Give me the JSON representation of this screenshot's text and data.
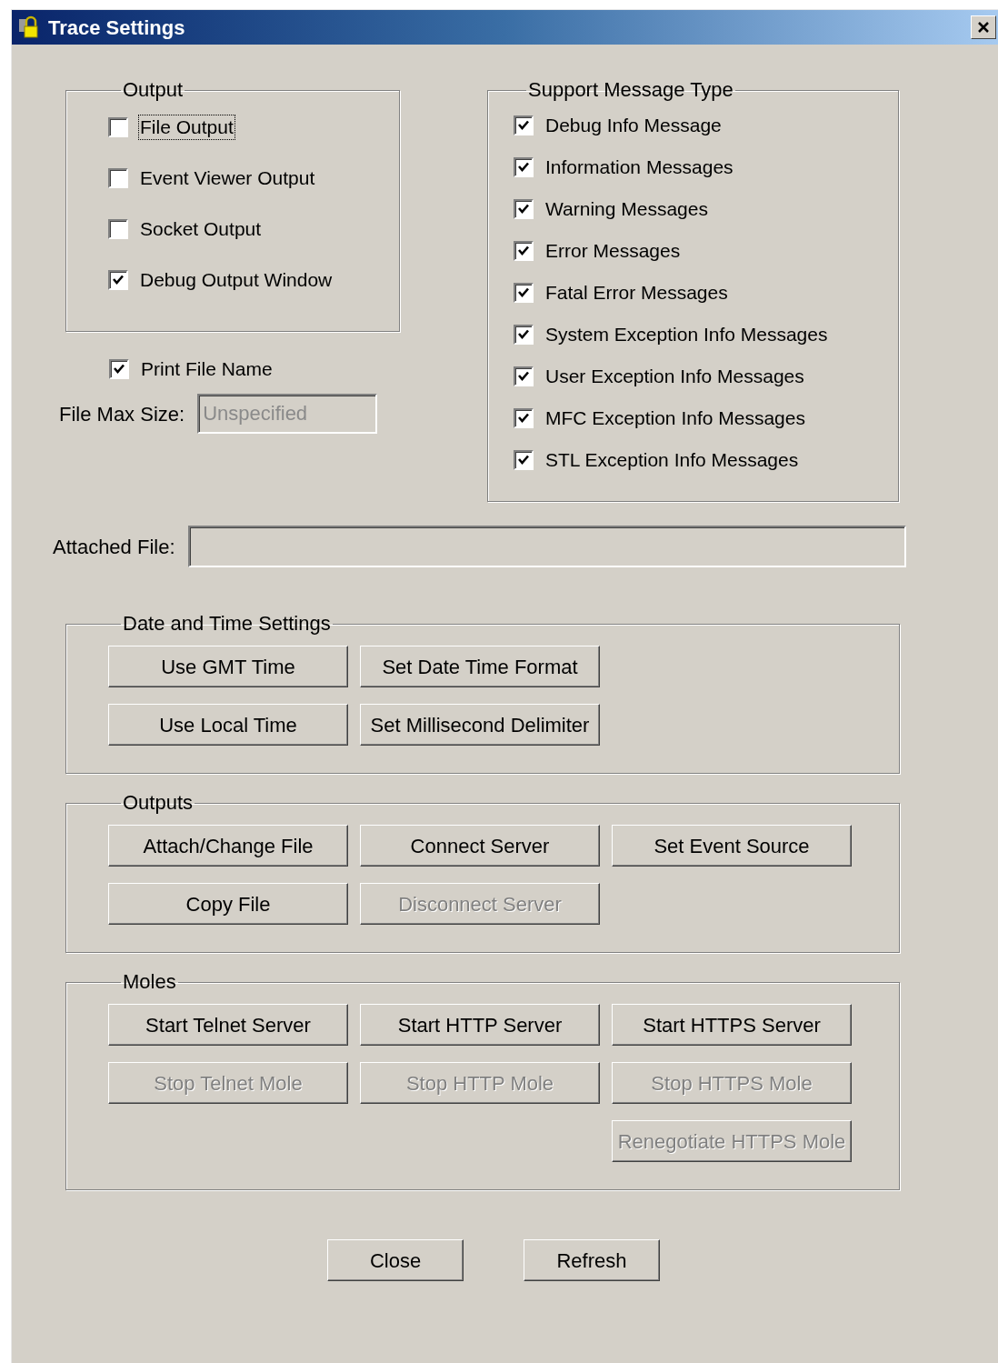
{
  "window": {
    "title": "Trace Settings"
  },
  "output_group": {
    "title": "Output",
    "options": [
      {
        "label": "File Output",
        "checked": false,
        "focused": true
      },
      {
        "label": "Event Viewer Output",
        "checked": false,
        "focused": false
      },
      {
        "label": "Socket Output",
        "checked": false,
        "focused": false
      },
      {
        "label": "Debug Output Window",
        "checked": true,
        "focused": false
      }
    ]
  },
  "print_file_name": {
    "label": "Print File Name",
    "checked": true
  },
  "file_max_size": {
    "label": "File Max Size:",
    "value": "Unspecified",
    "disabled": true
  },
  "support_group": {
    "title": "Support Message Type",
    "options": [
      {
        "label": "Debug Info Message",
        "checked": true
      },
      {
        "label": "Information Messages",
        "checked": true
      },
      {
        "label": "Warning Messages",
        "checked": true
      },
      {
        "label": "Error Messages",
        "checked": true
      },
      {
        "label": "Fatal Error Messages",
        "checked": true
      },
      {
        "label": "System Exception Info Messages",
        "checked": true
      },
      {
        "label": "User Exception Info Messages",
        "checked": true
      },
      {
        "label": "MFC Exception Info Messages",
        "checked": true
      },
      {
        "label": "STL Exception Info Messages",
        "checked": true
      }
    ]
  },
  "attached_file": {
    "label": "Attached File:"
  },
  "groups": [
    {
      "title": "Date and Time Settings",
      "columns": [
        {
          "buttons": [
            {
              "label": "Use GMT Time",
              "disabled": false
            },
            {
              "label": "Use Local Time",
              "disabled": false
            }
          ]
        },
        {
          "buttons": [
            {
              "label": "Set Date Time Format",
              "disabled": false
            },
            {
              "label": "Set Millisecond Delimiter",
              "disabled": false
            }
          ]
        }
      ]
    },
    {
      "title": "Outputs",
      "columns": [
        {
          "buttons": [
            {
              "label": "Attach/Change File",
              "disabled": false
            },
            {
              "label": "Copy File",
              "disabled": false
            }
          ]
        },
        {
          "buttons": [
            {
              "label": "Connect Server",
              "disabled": false
            },
            {
              "label": "Disconnect Server",
              "disabled": true
            }
          ]
        },
        {
          "buttons": [
            {
              "label": "Set Event Source",
              "disabled": false
            }
          ]
        }
      ]
    },
    {
      "title": "Moles",
      "columns": [
        {
          "buttons": [
            {
              "label": "Start Telnet Server",
              "disabled": false
            },
            {
              "label": "Stop Telnet Mole",
              "disabled": true
            }
          ]
        },
        {
          "buttons": [
            {
              "label": "Start HTTP Server",
              "disabled": false
            },
            {
              "label": "Stop HTTP Mole",
              "disabled": true
            }
          ]
        },
        {
          "buttons": [
            {
              "label": "Start HTTPS Server",
              "disabled": false
            },
            {
              "label": "Stop HTTPS Mole",
              "disabled": true
            },
            {
              "label": "Renegotiate HTTPS Mole",
              "disabled": true
            }
          ]
        }
      ]
    }
  ],
  "footer_buttons": [
    {
      "label": "Close"
    },
    {
      "label": "Refresh"
    }
  ]
}
